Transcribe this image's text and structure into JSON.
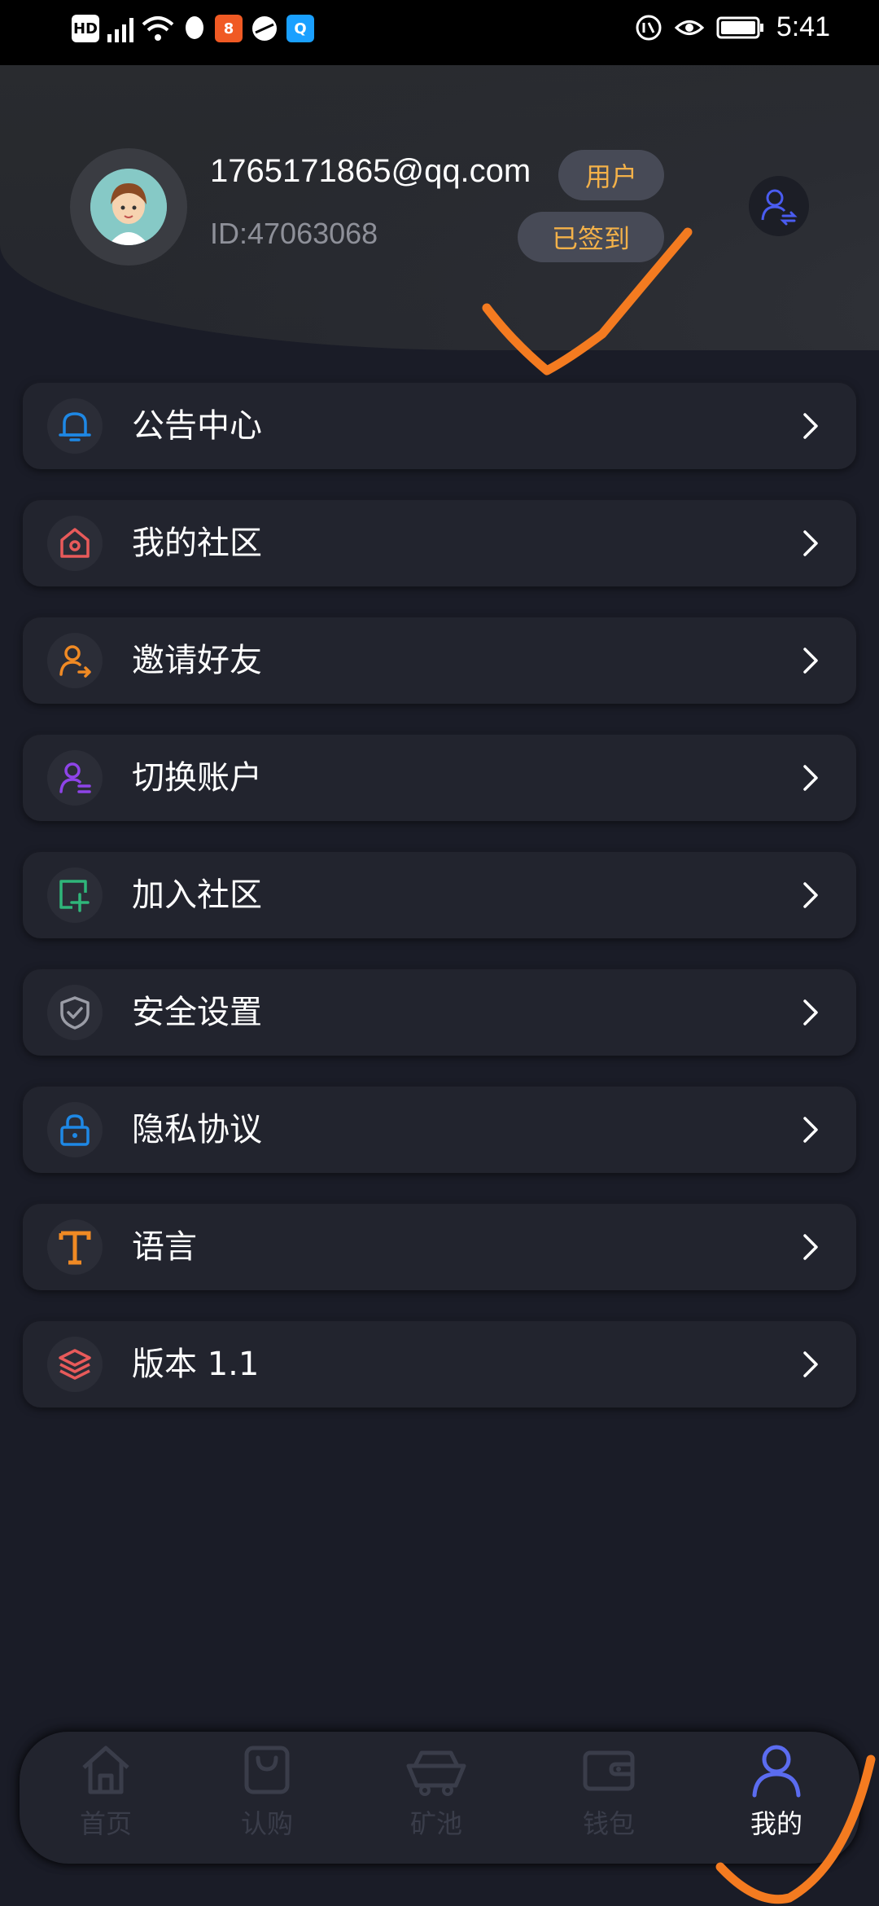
{
  "status_bar": {
    "left_icons": [
      "HD",
      "4G",
      "signal-icon",
      "wifi-icon",
      "qq-icon",
      "app-icon",
      "browser-icon",
      "search-app-icon"
    ],
    "right_icons": [
      "nfc-icon",
      "eye-icon",
      "battery-icon"
    ],
    "time": "5:41"
  },
  "profile": {
    "email": "1765171865@qq.com",
    "id_text": "ID:47063068",
    "role_badge": "用户",
    "signed_badge": "已签到"
  },
  "menu": {
    "items": [
      {
        "label": "公告中心",
        "icon": "bell-icon",
        "color": "#1e88e5"
      },
      {
        "label": "我的社区",
        "icon": "home-icon",
        "color": "#e85a5a"
      },
      {
        "label": "邀请好友",
        "icon": "invite-user-icon",
        "color": "#f08a24"
      },
      {
        "label": "切换账户",
        "icon": "switch-account-icon",
        "color": "#8e44e8"
      },
      {
        "label": "加入社区",
        "icon": "add-square-icon",
        "color": "#2fb67a"
      },
      {
        "label": "安全设置",
        "icon": "shield-icon",
        "color": "#9a9ca6"
      },
      {
        "label": "隐私协议",
        "icon": "lock-icon",
        "color": "#1e88e5"
      },
      {
        "label": "语言",
        "icon": "text-t-icon",
        "color": "#f08a24"
      },
      {
        "label": "版本 1.1",
        "icon": "layers-icon",
        "color": "#e85a5a"
      }
    ]
  },
  "bottom_nav": {
    "items": [
      {
        "label": "首页",
        "icon": "home-nav-icon",
        "active": false
      },
      {
        "label": "认购",
        "icon": "bag-icon",
        "active": false
      },
      {
        "label": "矿池",
        "icon": "mine-cart-icon",
        "active": false
      },
      {
        "label": "钱包",
        "icon": "wallet-icon",
        "active": false
      },
      {
        "label": "我的",
        "icon": "user-icon",
        "active": true
      }
    ],
    "active_color": "#5b6cf0"
  }
}
